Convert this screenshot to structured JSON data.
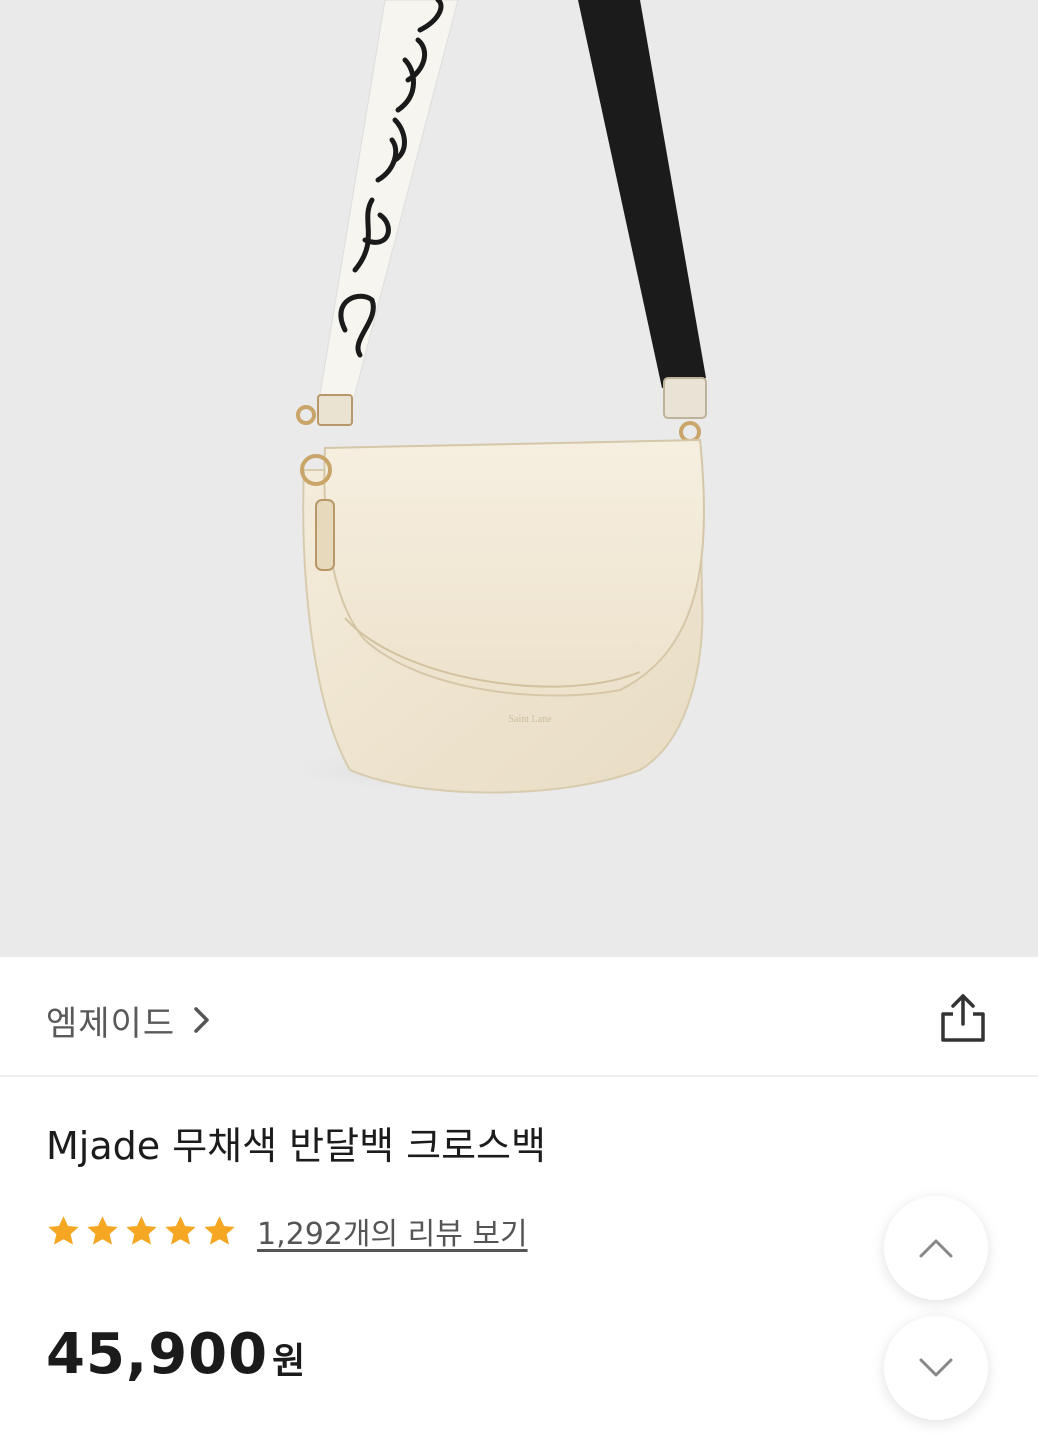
{
  "hero": {
    "image_alt": "product-photo",
    "strap_lettering": "I decide how"
  },
  "brand": {
    "name": "엠제이드",
    "chevron_icon": "chevron-right-icon",
    "share_icon": "share-icon"
  },
  "product": {
    "title": "Mjade 무채색 반달백 크로스백",
    "rating": {
      "stars": 5,
      "max": 5,
      "color": "#F5A623"
    },
    "review_link": "1,292개의 리뷰 보기",
    "price": {
      "amount": "45,900",
      "unit": "원"
    }
  },
  "floating": {
    "up_icon": "chevron-up-icon",
    "down_icon": "chevron-down-icon"
  }
}
